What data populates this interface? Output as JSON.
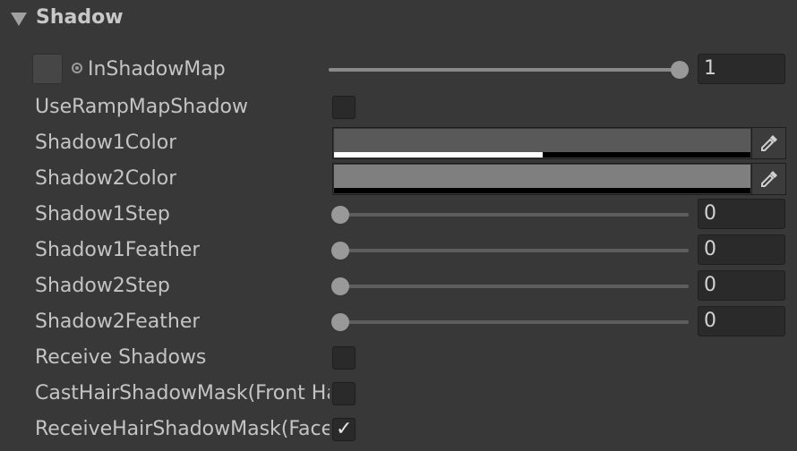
{
  "section": {
    "title": "Shadow"
  },
  "texture_prop": {
    "label": "InShadowMap",
    "value": "1",
    "slider_fraction": 1.0
  },
  "use_ramp_map_shadow": {
    "label": "UseRampMapShadow",
    "checked": false
  },
  "shadow1_color": {
    "label": "Shadow1Color",
    "color": "#595959",
    "alpha": 0.5
  },
  "shadow2_color": {
    "label": "Shadow2Color",
    "color": "#7f7f7f",
    "alpha": 0.0
  },
  "sliders": [
    {
      "label": "Shadow1Step",
      "value": "0",
      "fraction": 0.0
    },
    {
      "label": "Shadow1Feather",
      "value": "0",
      "fraction": 0.0
    },
    {
      "label": "Shadow2Step",
      "value": "0",
      "fraction": 0.0
    },
    {
      "label": "Shadow2Feather",
      "value": "0",
      "fraction": 0.0
    }
  ],
  "receive_shadows": {
    "label": "Receive Shadows",
    "checked": false
  },
  "cast_hair_shadow_mask": {
    "label": "CastHairShadowMask(Front Hair)",
    "checked": false
  },
  "receive_hair_shadow_mask": {
    "label": "ReceiveHairShadowMask(Face)",
    "checked": true
  },
  "icons": {
    "foldout": "triangle-down-icon",
    "texture_picker": "object-picker-icon",
    "eyedropper": "eyedropper-icon",
    "check": "checkmark-icon"
  }
}
